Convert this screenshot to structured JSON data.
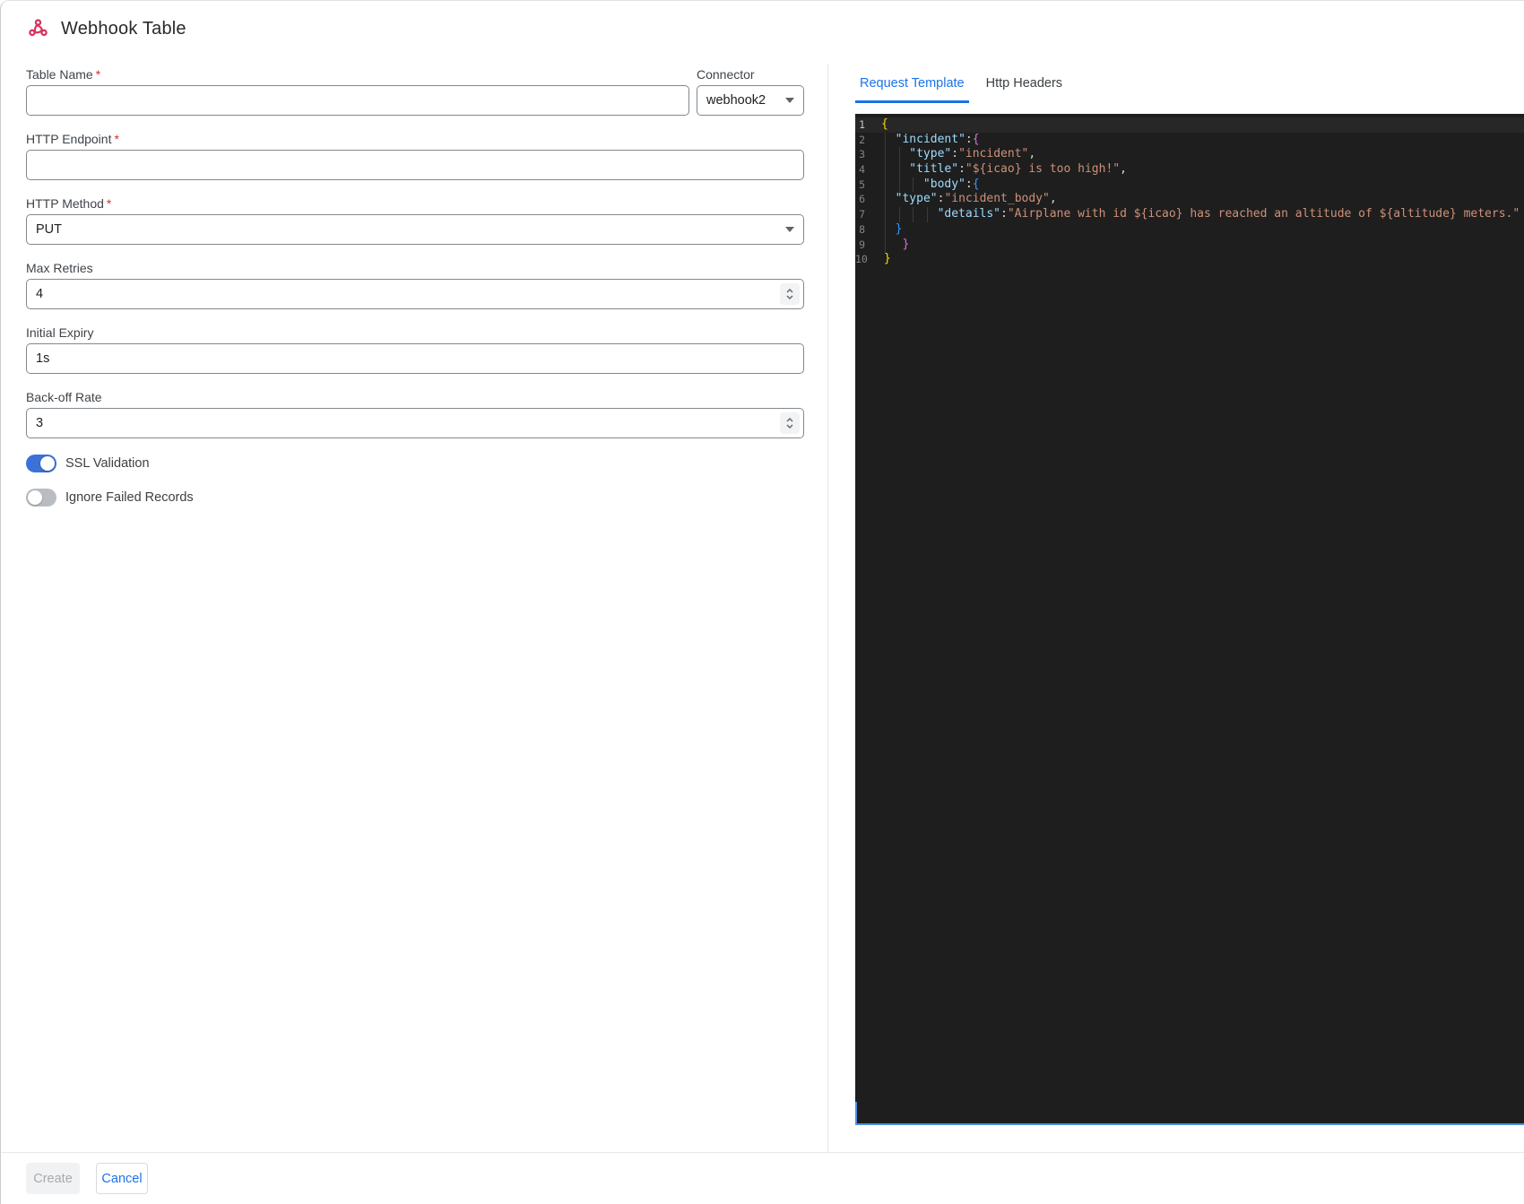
{
  "header": {
    "title": "Webhook Table",
    "icon": "webhook-icon",
    "icon_color": "#da335f"
  },
  "required_marker": "*",
  "form": {
    "table_name": {
      "label": "Table Name",
      "required": true,
      "value": ""
    },
    "connector": {
      "label": "Connector",
      "value": "webhook2"
    },
    "http_endpoint": {
      "label": "HTTP Endpoint",
      "required": true,
      "value": ""
    },
    "http_method": {
      "label": "HTTP Method",
      "required": true,
      "value": "PUT"
    },
    "max_retries": {
      "label": "Max Retries",
      "value": "4"
    },
    "initial_expiry": {
      "label": "Initial Expiry",
      "value": "1s"
    },
    "backoff_rate": {
      "label": "Back-off Rate",
      "value": "3"
    },
    "ssl_validation": {
      "label": "SSL Validation",
      "enabled": true
    },
    "ignore_failed_records": {
      "label": "Ignore Failed Records",
      "enabled": false
    }
  },
  "tabs": [
    {
      "label": "Request Template",
      "active": true
    },
    {
      "label": "Http Headers",
      "active": false
    }
  ],
  "editor": {
    "language": "json",
    "active_line": 1,
    "colors": {
      "background": "#1e1e1e",
      "focus_border": "#4a90e2"
    },
    "lines": [
      {
        "n": 1,
        "indent": 0,
        "tokens": [
          [
            "b1",
            "{"
          ]
        ]
      },
      {
        "n": 2,
        "indent": 2,
        "tokens": [
          [
            "k",
            "\"incident\""
          ],
          [
            "p",
            ":"
          ],
          [
            "b2",
            "{"
          ]
        ]
      },
      {
        "n": 3,
        "indent": 4,
        "tokens": [
          [
            "k",
            "\"type\""
          ],
          [
            "p",
            ":"
          ],
          [
            "s",
            "\"incident\""
          ],
          [
            "p",
            ","
          ]
        ]
      },
      {
        "n": 4,
        "indent": 4,
        "tokens": [
          [
            "k",
            "\"title\""
          ],
          [
            "p",
            ":"
          ],
          [
            "s",
            "\"${icao} is too high!\""
          ],
          [
            "p",
            ","
          ]
        ]
      },
      {
        "n": 5,
        "indent": 6,
        "tokens": [
          [
            "k",
            "\"body\""
          ],
          [
            "p",
            ":"
          ],
          [
            "b3",
            "{"
          ]
        ]
      },
      {
        "n": 6,
        "indent": 2,
        "tokens": [
          [
            "k",
            "\"type\""
          ],
          [
            "p",
            ":"
          ],
          [
            "s",
            "\"incident_body\""
          ],
          [
            "p",
            ","
          ]
        ]
      },
      {
        "n": 7,
        "indent": 8,
        "tokens": [
          [
            "k",
            "\"details\""
          ],
          [
            "p",
            ":"
          ],
          [
            "s",
            "\"Airplane with id ${icao} has reached an altitude of ${altitude} meters.\""
          ]
        ]
      },
      {
        "n": 8,
        "indent": 2,
        "tokens": [
          [
            "b3",
            "}"
          ]
        ]
      },
      {
        "n": 9,
        "indent": 3,
        "tokens": [
          [
            "b2",
            "}"
          ]
        ]
      },
      {
        "n": 10,
        "indent": 0,
        "tokens": [
          [
            "b1",
            "}"
          ]
        ]
      }
    ]
  },
  "footer": {
    "create_label": "Create",
    "create_disabled": true,
    "cancel_label": "Cancel"
  }
}
